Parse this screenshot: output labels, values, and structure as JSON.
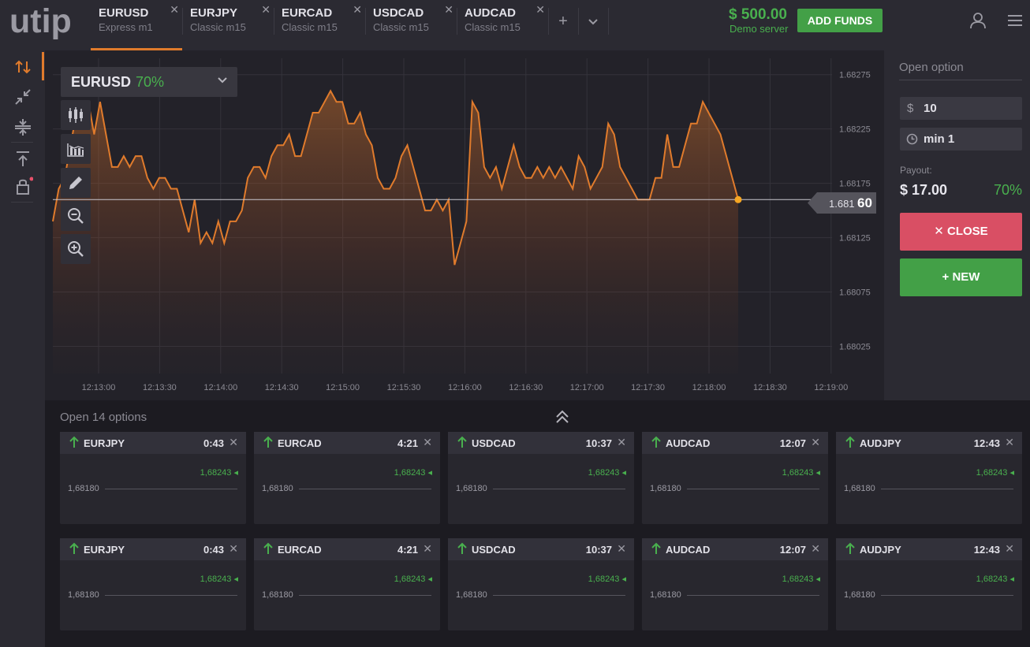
{
  "app": {
    "logo": "utip"
  },
  "tabs": [
    {
      "symbol": "EURUSD",
      "sub": "Express m1",
      "active": true
    },
    {
      "symbol": "EURJPY",
      "sub": "Classic  m15"
    },
    {
      "symbol": "EURCAD",
      "sub": "Classic  m15"
    },
    {
      "symbol": "USDCAD",
      "sub": "Classic  m15"
    },
    {
      "symbol": "AUDCAD",
      "sub": "Classic  m15"
    }
  ],
  "header": {
    "balance": "$ 500.00",
    "server": "Demo server",
    "add_funds": "ADD FUNDS",
    "add_tab": "+",
    "more_tabs": "⌄"
  },
  "asset": {
    "name": "EURUSD",
    "payout_pct": "70%"
  },
  "chart": {
    "price_label_main": "1.681",
    "price_label_big": "60",
    "accent": "#e07b2c"
  },
  "chart_data": {
    "type": "area",
    "symbol": "EURUSD",
    "y_ticks": [
      "1.68275",
      "1.68225",
      "1.68175",
      "1.68125",
      "1.68075",
      "1.68025"
    ],
    "x_ticks": [
      "12:13:00",
      "12:13:30",
      "12:14:00",
      "12:14:30",
      "12:15:00",
      "12:15:30",
      "12:16:00",
      "12:16:30",
      "12:17:00",
      "12:17:30",
      "12:18:00",
      "12:18:30",
      "12:19:00"
    ],
    "ylim": [
      1.68,
      1.6829
    ],
    "current_price": 1.6816,
    "series": [
      {
        "values": [
          1.6814,
          1.6817,
          1.6818,
          1.6821,
          1.6824,
          1.6823,
          1.6825,
          1.6822,
          1.6825,
          1.6822,
          1.6819,
          1.6819,
          1.682,
          1.6819,
          1.682,
          1.682,
          1.6818,
          1.6817,
          1.6818,
          1.6818,
          1.6817,
          1.6817,
          1.6815,
          1.6813,
          1.6816,
          1.6812,
          1.6813,
          1.6812,
          1.6814,
          1.6812,
          1.6814,
          1.6814,
          1.6815,
          1.6818,
          1.6819,
          1.6819,
          1.6818,
          1.682,
          1.6821,
          1.6821,
          1.6822,
          1.682,
          1.682,
          1.6822,
          1.6824,
          1.6824,
          1.6825,
          1.6826,
          1.6825,
          1.6825,
          1.6823,
          1.6823,
          1.6824,
          1.6822,
          1.6821,
          1.6818,
          1.6817,
          1.6817,
          1.6818,
          1.682,
          1.6821,
          1.6819,
          1.6817,
          1.6815,
          1.6815,
          1.6816,
          1.6815,
          1.6816,
          1.681,
          1.6812,
          1.6814,
          1.6825,
          1.6824,
          1.6819,
          1.6818,
          1.6819,
          1.6817,
          1.6819,
          1.6821,
          1.6819,
          1.6818,
          1.6818,
          1.6819,
          1.6818,
          1.6819,
          1.6818,
          1.6819,
          1.6818,
          1.6817,
          1.682,
          1.6819,
          1.6817,
          1.6818,
          1.6819,
          1.6823,
          1.6822,
          1.6819,
          1.6818,
          1.6817,
          1.6816,
          1.6816,
          1.6816,
          1.6818,
          1.6818,
          1.6822,
          1.6819,
          1.6819,
          1.6821,
          1.6823,
          1.6823,
          1.6825,
          1.6824,
          1.6823,
          1.6822,
          1.682,
          1.6818,
          1.6816
        ]
      }
    ]
  },
  "open_option": {
    "title": "Open option",
    "amount": "10",
    "amount_icon": "$",
    "duration": "min 1",
    "payout_label": "Payout:",
    "payout_value": "$ 17.00",
    "payout_pct": "70%",
    "close_label": "✕ CLOSE",
    "new_label": "+ NEW"
  },
  "options": {
    "title": "Open 14 options",
    "cards": [
      {
        "symbol": "EURJPY",
        "time": "0:43",
        "current": "1,68243 ◂",
        "open": "1,68180"
      },
      {
        "symbol": "EURCAD",
        "time": "4:21",
        "current": "1,68243 ◂",
        "open": "1,68180"
      },
      {
        "symbol": "USDCAD",
        "time": "10:37",
        "current": "1,68243 ◂",
        "open": "1,68180"
      },
      {
        "symbol": "AUDCAD",
        "time": "12:07",
        "current": "1,68243 ◂",
        "open": "1,68180"
      },
      {
        "symbol": "AUDJPY",
        "time": "12:43",
        "current": "1,68243 ◂",
        "open": "1,68180"
      },
      {
        "symbol": "EURJPY",
        "time": "0:43",
        "current": "1,68243 ◂",
        "open": "1,68180"
      },
      {
        "symbol": "EURCAD",
        "time": "4:21",
        "current": "1,68243 ◂",
        "open": "1,68180"
      },
      {
        "symbol": "USDCAD",
        "time": "10:37",
        "current": "1,68243 ◂",
        "open": "1,68180"
      },
      {
        "symbol": "AUDCAD",
        "time": "12:07",
        "current": "1,68243 ◂",
        "open": "1,68180"
      },
      {
        "symbol": "AUDJPY",
        "time": "12:43",
        "current": "1,68243 ◂",
        "open": "1,68180"
      }
    ]
  },
  "icons": {
    "user": "user-icon",
    "menu": "hamburger-icon",
    "left_tools": [
      "up-down-arrows-icon",
      "shrink-arrows-icon",
      "compress-icon",
      "upload-icon",
      "lock-icon"
    ],
    "chart_tools": [
      "candles-icon",
      "bars-icon",
      "pencil-icon",
      "zoom-out-icon",
      "zoom-in-icon"
    ]
  }
}
